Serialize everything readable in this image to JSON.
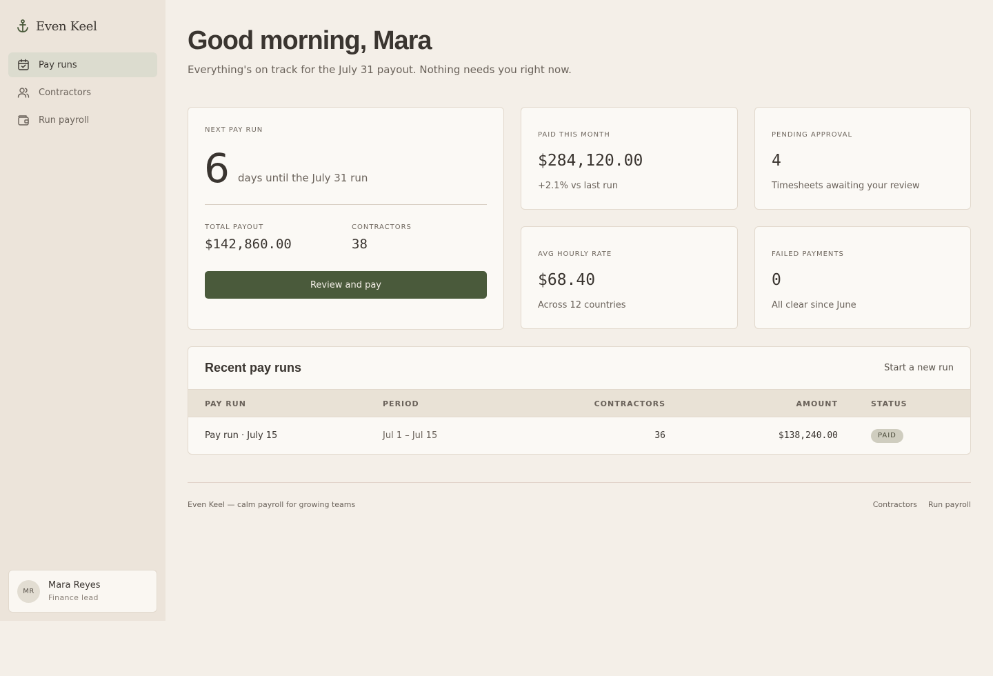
{
  "brand": {
    "name": "Even Keel",
    "icon": "anchor-icon"
  },
  "sidebar": {
    "items": [
      {
        "label": "Pay runs",
        "icon": "calendar-check-icon",
        "active": true
      },
      {
        "label": "Contractors",
        "icon": "users-icon",
        "active": false
      },
      {
        "label": "Run payroll",
        "icon": "wallet-icon",
        "active": false
      }
    ],
    "user": {
      "initials": "MR",
      "name": "Mara Reyes",
      "role": "Finance lead"
    }
  },
  "header": {
    "greeting": "Good morning, Mara",
    "subtitle": "Everything's on track for the July 31 payout. Nothing needs you right now."
  },
  "next_run": {
    "label": "NEXT PAY RUN",
    "days": "6",
    "days_text": "days until the July 31 run",
    "total_label": "TOTAL PAYOUT",
    "total_value": "$142,860.00",
    "contractors_label": "CONTRACTORS",
    "contractors_value": "38",
    "button_label": "Review and pay"
  },
  "stats": [
    {
      "label": "PAID THIS MONTH",
      "value": "$284,120.00",
      "note": "+2.1% vs last run"
    },
    {
      "label": "PENDING APPROVAL",
      "value": "4",
      "note": "Timesheets awaiting your review"
    },
    {
      "label": "AVG HOURLY RATE",
      "value": "$68.40",
      "note": "Across 12 countries"
    },
    {
      "label": "FAILED PAYMENTS",
      "value": "0",
      "note": "All clear since June"
    }
  ],
  "recent": {
    "title": "Recent pay runs",
    "action": "Start a new run",
    "columns": [
      "PAY RUN",
      "PERIOD",
      "CONTRACTORS",
      "AMOUNT",
      "STATUS"
    ],
    "rows": [
      {
        "name": "Pay run · July 15",
        "period": "Jul 1 – Jul 15",
        "contractors": "36",
        "amount": "$138,240.00",
        "status": "PAID"
      }
    ]
  },
  "footer": {
    "tagline": "Even Keel — calm payroll for growing teams",
    "links": [
      "Contractors",
      "Run payroll"
    ]
  },
  "colors": {
    "accent": "#4a5a3b",
    "background": "#f4efe8",
    "sidebar": "#ece4da",
    "card": "#fbf9f5"
  }
}
